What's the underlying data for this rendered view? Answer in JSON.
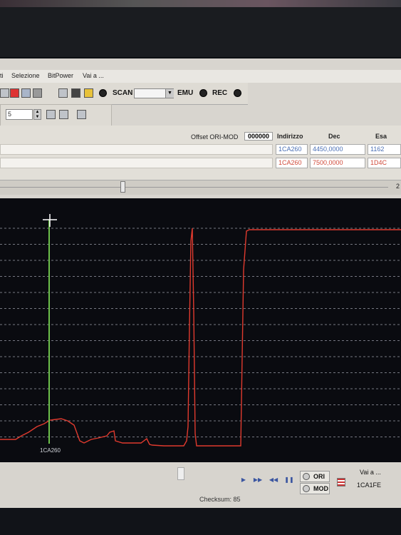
{
  "menu": {
    "items": [
      {
        "label": "ti"
      },
      {
        "label": "Selezione"
      },
      {
        "label": "BitPower"
      },
      {
        "label": "Vai a ..."
      }
    ]
  },
  "toolbar": {
    "scan_label": "SCAN",
    "emu_label": "EMU",
    "rec_label": "REC",
    "stepper_value": "5"
  },
  "data_table": {
    "offset_label": "Offset ORI-MOD",
    "offset_value": "000000",
    "headers": {
      "address": "Indirizzo",
      "dec": "Dec",
      "hex": "Esa"
    },
    "rows": [
      {
        "address": "1CA260",
        "dec": "4450,0000",
        "hex": "1162",
        "color": "#4a6fb5"
      },
      {
        "address": "1CA260",
        "dec": "7500,0000",
        "hex": "1D4C",
        "color": "#d04a3a"
      }
    ]
  },
  "slider": {
    "value_text": "2",
    "position": 0.31
  },
  "graph": {
    "cursor_address": "1CA260",
    "ori_color": "#6cc04a",
    "mod_color": "#e03a2e",
    "grid_color": "#9a9da8"
  },
  "bottom": {
    "ori_label": "ORI",
    "mod_label": "MOD",
    "goto_label": "Vai a ...",
    "goto_value": "1CA1FE",
    "checksum": "Checksum: 85"
  }
}
